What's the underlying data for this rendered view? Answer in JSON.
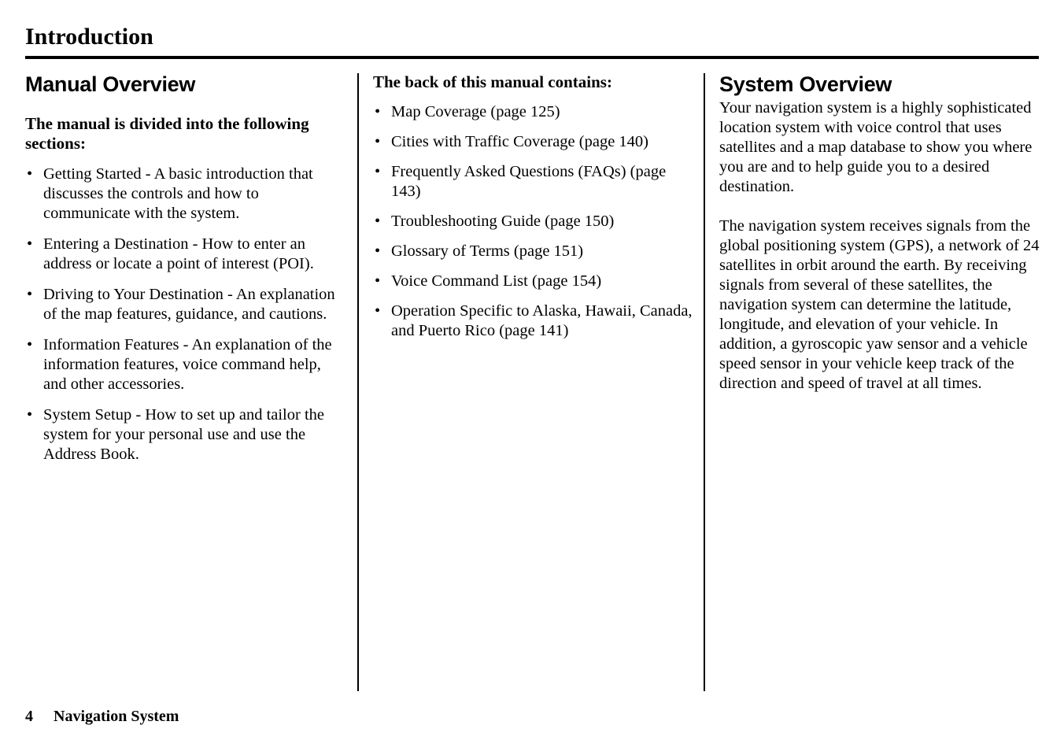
{
  "document": {
    "title": "Introduction",
    "rule_color": "#000000"
  },
  "columns": {
    "left": {
      "heading": "Manual Overview",
      "subheading": "The manual is divided into the following sections:",
      "bullets": [
        "Getting Started - A basic introduction that discusses the controls and how to communicate with the system.",
        "Entering a Destination - How to enter an address or locate a point of interest (POI).",
        "Driving to Your Destination - An explanation of the map features, guidance, and cautions.",
        "Information Features - An explanation of the information features, voice command help, and other accessories.",
        "System Setup - How to set up and tailor the system for your personal use and use the Address Book."
      ]
    },
    "middle": {
      "heading": "The back of this manual contains:",
      "bullets": [
        "Map Coverage (page 125)",
        "Cities with Traffic Coverage (page 140)",
        "Frequently Asked Questions (FAQs) (page 143)",
        "Troubleshooting Guide (page 150)",
        "Glossary of Terms (page 151)",
        "Voice Command List (page 154)",
        "Operation Specific to Alaska, Hawaii, Canada, and Puerto Rico (page 141)"
      ]
    },
    "right": {
      "heading": "System Overview",
      "paragraphs": [
        "Your navigation system is a highly sophisticated location system with voice control that uses satellites and a map database to show you where you are and to help guide you to a desired destination.",
        "The navigation system receives signals from the global positioning system (GPS), a network of 24 satellites in orbit around the earth. By receiving signals from several of these satellites, the navigation system can determine the latitude, longitude, and elevation of your vehicle. In addition, a gyroscopic yaw sensor and a vehicle speed sensor in your vehicle keep track of the direction and speed of travel at all times."
      ]
    }
  },
  "footer": {
    "page_number": "4",
    "manual_name": "Navigation System"
  },
  "icons": {
    "bullet": "•"
  }
}
